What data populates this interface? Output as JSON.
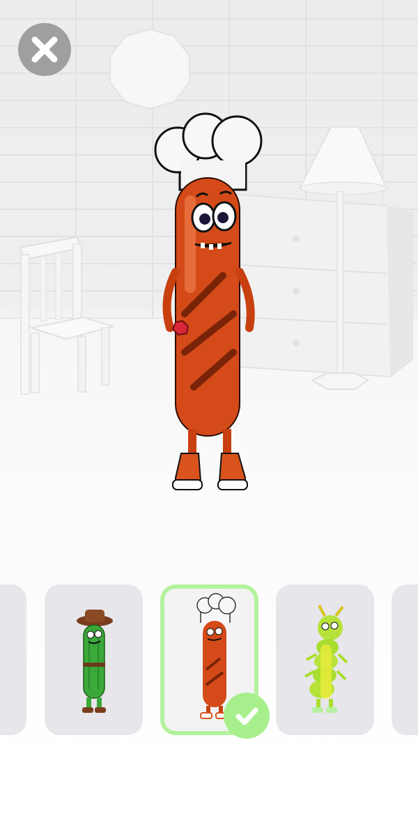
{
  "screen": "character-select",
  "close_button": {
    "icon": "close-icon",
    "color": "#9f9f9f"
  },
  "preview": {
    "character": "sausage-chef",
    "accessory": "chef-hat",
    "body_color": "#d44a19"
  },
  "carousel": {
    "selected_index": 2,
    "selected_border_color": "#b4f29e",
    "check_icon": "checkmark-icon",
    "items": [
      {
        "id": "partial-left",
        "character": "unknown"
      },
      {
        "id": "pickle-cowboy",
        "character": "pickle-cowboy"
      },
      {
        "id": "sausage-chef",
        "character": "sausage-chef"
      },
      {
        "id": "caterpillar",
        "character": "caterpillar"
      },
      {
        "id": "partial-right",
        "character": "unknown"
      }
    ]
  }
}
